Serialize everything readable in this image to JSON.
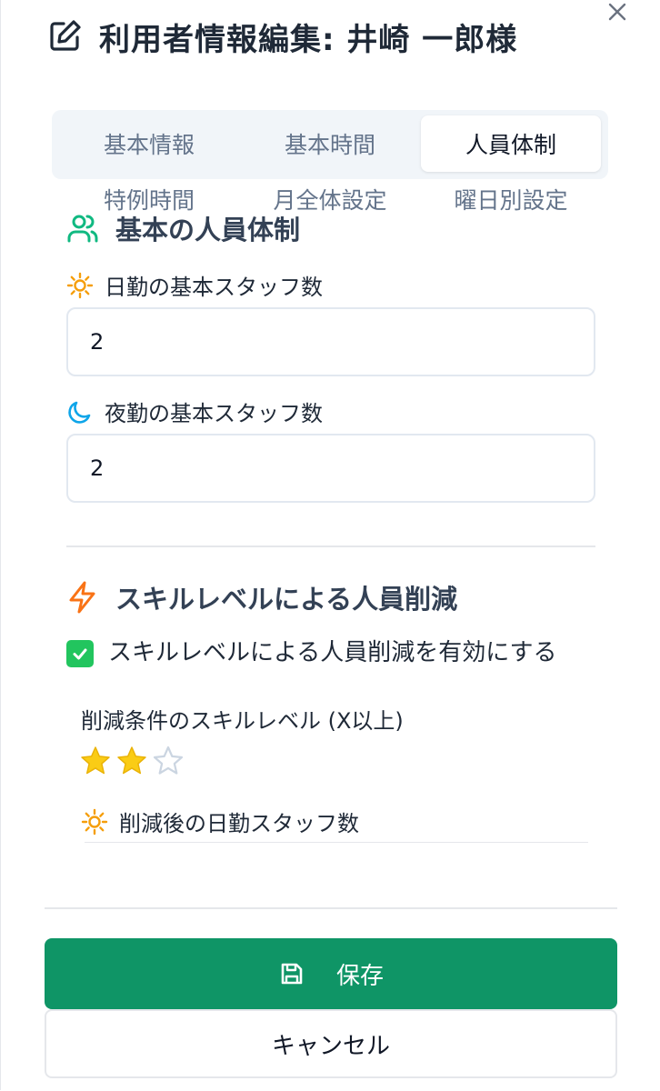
{
  "dialog": {
    "title": "利用者情報編集: 井崎 一郎様"
  },
  "tabs": [
    {
      "label": "基本情報",
      "active": false
    },
    {
      "label": "基本時間",
      "active": false
    },
    {
      "label": "人員体制",
      "active": true
    },
    {
      "label": "特例時間",
      "active": false
    },
    {
      "label": "月全体設定",
      "active": false
    },
    {
      "label": "曜日別設定",
      "active": false
    }
  ],
  "staffing": {
    "section_title": "基本の人員体制",
    "day_label": "日勤の基本スタッフ数",
    "day_value": "2",
    "night_label": "夜勤の基本スタッフ数",
    "night_value": "2"
  },
  "skill": {
    "section_title": "スキルレベルによる人員削減",
    "enable_label": "スキルレベルによる人員削減を有効にする",
    "enabled": true,
    "level_label": "削減条件のスキルレベル (X以上)",
    "level_rating": 2,
    "level_max": 3,
    "reduced_day_label": "削減後の日勤スタッフ数"
  },
  "footer": {
    "save_label": "保存",
    "cancel_label": "キャンセル"
  },
  "colors": {
    "primary": "#0f9566",
    "checkbox": "#22c55e",
    "star_filled": "#facc15",
    "sun_icon": "#f59e0b",
    "moon_icon": "#0ea5e9",
    "bolt_icon": "#f97316",
    "users_icon": "#10b981"
  }
}
